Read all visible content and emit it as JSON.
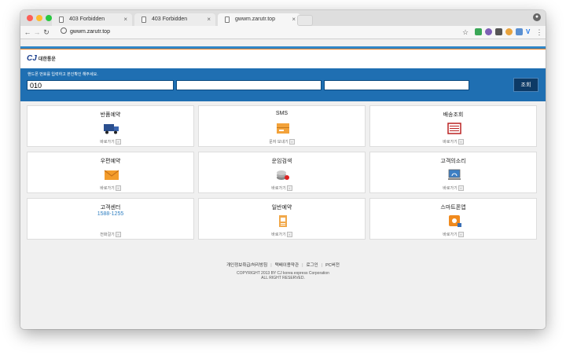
{
  "browser": {
    "tabs": [
      {
        "label": "403 Forbidden",
        "active": false
      },
      {
        "label": "403 Forbidden",
        "active": false
      },
      {
        "label": "gwwm.zarutr.top",
        "active": true
      }
    ],
    "url": "gwwm.zarutr.top"
  },
  "brand": {
    "name": "CJ",
    "korean": "대한통운"
  },
  "phone_form": {
    "instruction": "핸드폰 번호를 입력하고 본인확인 해주세요.",
    "field1_value": "010",
    "field2_value": "",
    "field3_value": "",
    "search_label": "조회"
  },
  "services": [
    {
      "title": "반품예약",
      "link": "바로가기",
      "icon": "delivery-truck-icon"
    },
    {
      "title": "SMS",
      "link": "문자 보내기",
      "icon": "sms-box-icon"
    },
    {
      "title": "배송조회",
      "link": "바로가기",
      "icon": "tracking-window-icon"
    },
    {
      "title": "우편예약",
      "link": "바로가기",
      "icon": "envelope-icon"
    },
    {
      "title": "운임검색",
      "link": "바로가기",
      "icon": "coins-icon"
    },
    {
      "title": "고객의소리",
      "link": "바로가기",
      "icon": "customer-voice-monitor-icon"
    },
    {
      "title": "고객센터",
      "phone": "1588-1255",
      "link": "전화걸기",
      "icon": ""
    },
    {
      "title": "일반예약",
      "link": "바로가기",
      "icon": "reservation-form-icon"
    },
    {
      "title": "스마트폰앱",
      "link": "바로가기",
      "icon": "smartphone-app-icon"
    }
  ],
  "footer": {
    "links": [
      "개인정보취급/처리방침",
      "택배이용약관",
      "로그인",
      "PC버전"
    ],
    "copyright_line1": "COPYRIGHT 2013 BY CJ korea express Corporation",
    "copyright_line2": "ALL RIGHT RESERVED."
  },
  "colors": {
    "brand_blue": "#1f6fb2",
    "accent_orange": "#f07d1a",
    "dark_button": "#0d3a66"
  }
}
